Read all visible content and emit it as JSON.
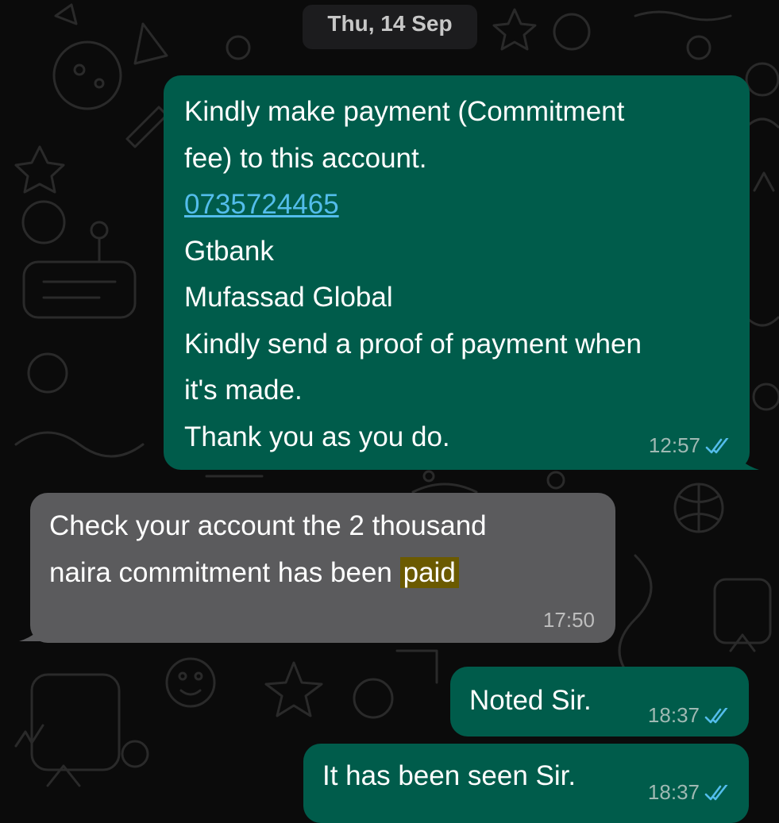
{
  "chat": {
    "date_label": "Thu, 14 Sep",
    "messages": [
      {
        "direction": "outgoing",
        "lines": [
          "Kindly make payment (Commitment",
          "fee) to this account.",
          "0735724465",
          "Gtbank",
          "Mufassad Global",
          "Kindly send a proof of payment when",
          "it's made.",
          "Thank you as you do."
        ],
        "time": "12:57",
        "status": "read"
      },
      {
        "direction": "incoming",
        "line1": "Check your account the 2 thousand",
        "line2_before": "naira commitment has been ",
        "line2_highlight": "paid",
        "time": "17:50"
      },
      {
        "direction": "outgoing",
        "text": "Noted Sir.",
        "time": "18:37",
        "status": "read"
      },
      {
        "direction": "outgoing",
        "text": "It has been seen Sir.",
        "time": "18:37",
        "status": "read"
      }
    ]
  },
  "colors": {
    "background": "#0b0b0b",
    "outgoing_bubble": "#005c4b",
    "incoming_bubble": "#5b5b5d",
    "link": "#53bdeb",
    "read_ticks": "#53bdeb",
    "search_highlight": "#6b5a00"
  },
  "icons": {
    "read_receipt": "double-check-icon",
    "wallpaper": "doodle-pattern"
  }
}
